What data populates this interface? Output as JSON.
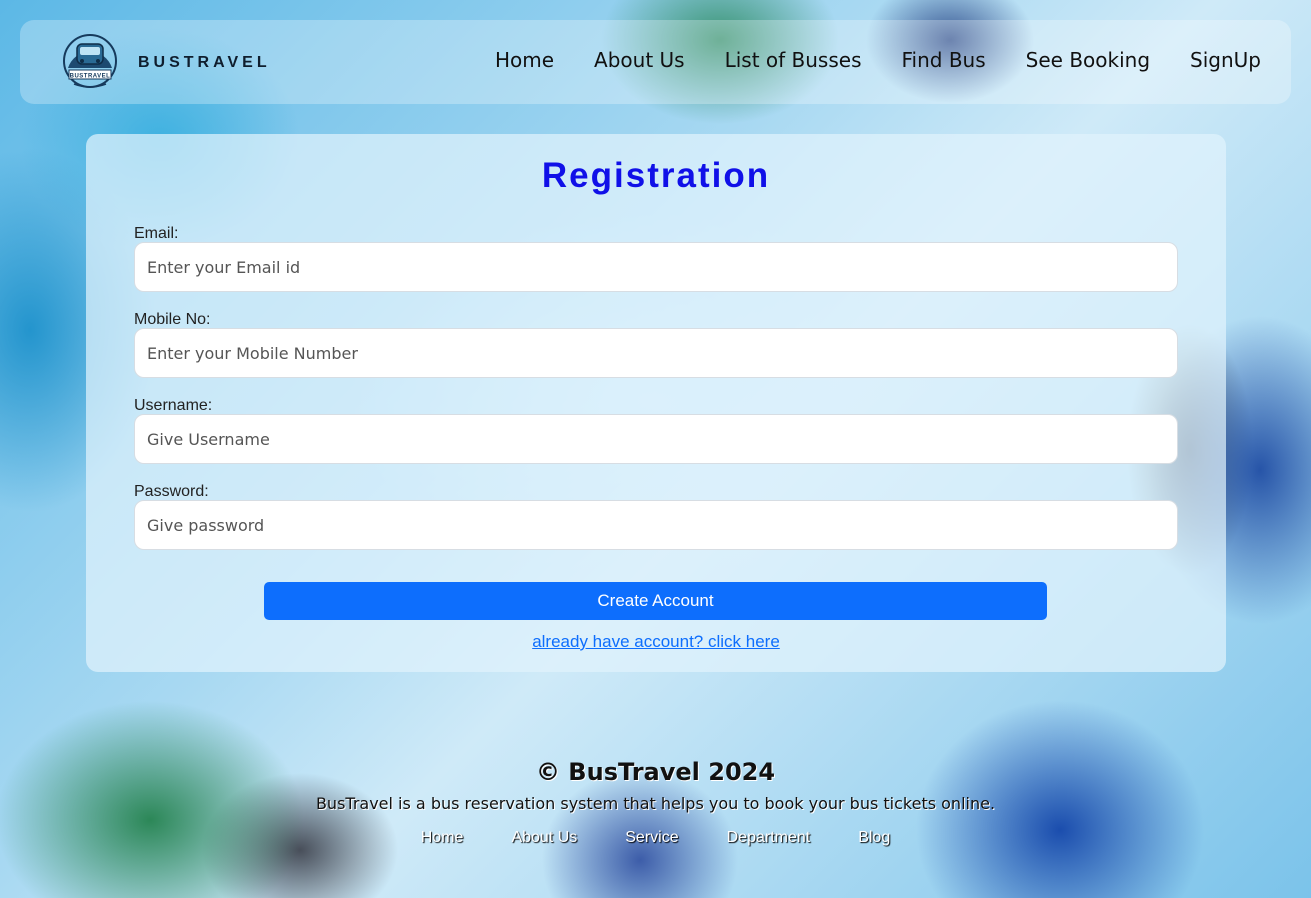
{
  "brand": {
    "name": "BUSTRAVEL",
    "logo_icon": "bus-logo-icon",
    "logo_text": "BUSTRAVEL"
  },
  "nav": {
    "links": [
      "Home",
      "About Us",
      "List of Busses",
      "Find Bus",
      "See Booking",
      "SignUp"
    ]
  },
  "form": {
    "title": "Registration",
    "fields": [
      {
        "label": "Email:",
        "placeholder": "Enter your Email id",
        "value": ""
      },
      {
        "label": "Mobile No:",
        "placeholder": "Enter your Mobile Number",
        "value": ""
      },
      {
        "label": "Username:",
        "placeholder": "Give Username",
        "value": ""
      },
      {
        "label": "Password:",
        "placeholder": "Give password",
        "value": ""
      }
    ],
    "submit_label": "Create Account",
    "login_link": "already have account? click here"
  },
  "footer": {
    "copyright": "© BusTravel 2024",
    "description": "BusTravel is a bus reservation system that helps you to book your bus tickets online.",
    "links": [
      "Home",
      "About Us",
      "Service",
      "Department",
      "Blog"
    ]
  },
  "colors": {
    "title": "#1010e8",
    "primary_button": "#0d6efd",
    "link": "#0d6efd"
  }
}
